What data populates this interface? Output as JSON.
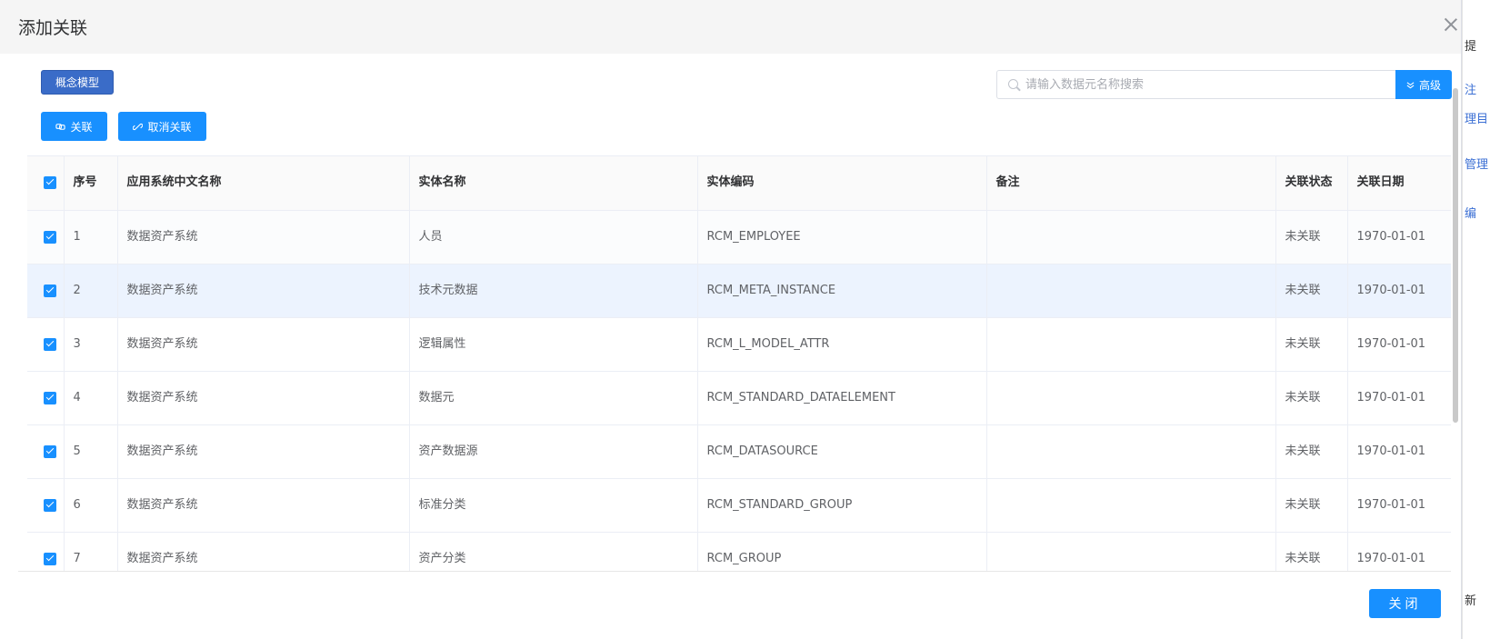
{
  "dialog": {
    "title": "添加关联"
  },
  "toolbar": {
    "model_label": "概念模型",
    "link_label": "关联",
    "unlink_label": "取消关联",
    "search_placeholder": "请输入数据元名称搜索",
    "advanced_label": "高级"
  },
  "table": {
    "headers": [
      "序号",
      "应用系统中文名称",
      "实体名称",
      "实体编码",
      "备注",
      "关联状态",
      "关联日期"
    ],
    "rows": [
      {
        "no": "1",
        "system": "数据资产系统",
        "entity": "人员",
        "code": "RCM_EMPLOYEE",
        "note": "",
        "status": "未关联",
        "date": "1970-01-01"
      },
      {
        "no": "2",
        "system": "数据资产系统",
        "entity": "技术元数据",
        "code": "RCM_META_INSTANCE",
        "note": "",
        "status": "未关联",
        "date": "1970-01-01"
      },
      {
        "no": "3",
        "system": "数据资产系统",
        "entity": "逻辑属性",
        "code": "RCM_L_MODEL_ATTR",
        "note": "",
        "status": "未关联",
        "date": "1970-01-01"
      },
      {
        "no": "4",
        "system": "数据资产系统",
        "entity": "数据元",
        "code": "RCM_STANDARD_DATAELEMENT",
        "note": "",
        "status": "未关联",
        "date": "1970-01-01"
      },
      {
        "no": "5",
        "system": "数据资产系统",
        "entity": "资产数据源",
        "code": "RCM_DATASOURCE",
        "note": "",
        "status": "未关联",
        "date": "1970-01-01"
      },
      {
        "no": "6",
        "system": "数据资产系统",
        "entity": "标准分类",
        "code": "RCM_STANDARD_GROUP",
        "note": "",
        "status": "未关联",
        "date": "1970-01-01"
      },
      {
        "no": "7",
        "system": "数据资产系统",
        "entity": "资产分类",
        "code": "RCM_GROUP",
        "note": "",
        "status": "未关联",
        "date": "1970-01-01"
      }
    ]
  },
  "footer": {
    "close_label": "关闭"
  },
  "colors": {
    "primary": "#1890ff",
    "model_button": "#3a6cc8",
    "selected_row": "#ecf3fe"
  },
  "icons": [
    "close-icon",
    "search-icon",
    "link-icon",
    "unlink-icon",
    "chevron-down-icon",
    "checkbox-checked-icon"
  ]
}
